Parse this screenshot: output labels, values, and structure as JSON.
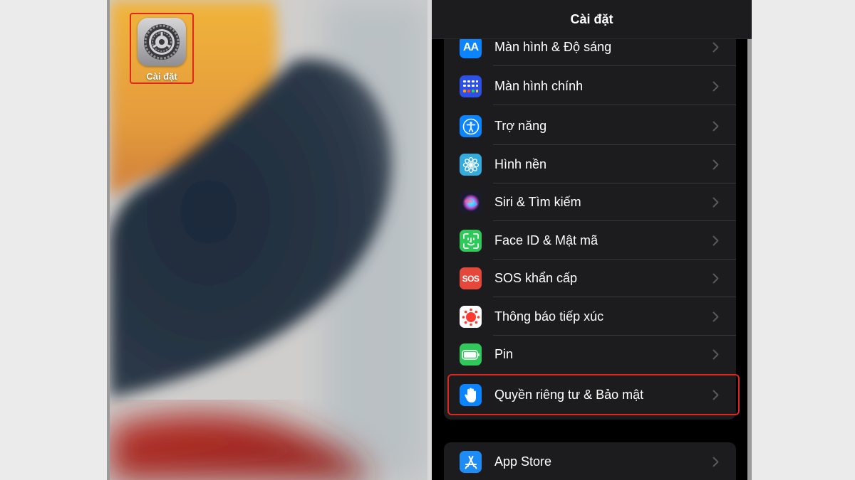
{
  "home_screen": {
    "app_label": "Cài đặt",
    "app_icon": "settings-gear-icon"
  },
  "settings": {
    "title": "Cài đặt",
    "rows": [
      {
        "label": "Màn hình & Độ sáng",
        "icon": "text-size-icon",
        "color": "#0a84ff"
      },
      {
        "label": "Màn hình chính",
        "icon": "home-screen-grid-icon",
        "color": "#2c50e8"
      },
      {
        "label": "Trợ năng",
        "icon": "accessibility-icon",
        "color": "#0a84ff"
      },
      {
        "label": "Hình nền",
        "icon": "wallpaper-flower-icon",
        "color": "#35aadc"
      },
      {
        "label": "Siri & Tìm kiếm",
        "icon": "siri-icon",
        "color": "#1b1b2e"
      },
      {
        "label": "Face ID & Mật mã",
        "icon": "face-id-icon",
        "color": "#30c85a"
      },
      {
        "label": "SOS khẩn cấp",
        "icon": "sos-icon",
        "color": "#e5483b"
      },
      {
        "label": "Thông báo tiếp xúc",
        "icon": "exposure-notification-icon",
        "color": "#ffffff"
      },
      {
        "label": "Pin",
        "icon": "battery-icon",
        "color": "#30c85a"
      },
      {
        "label": "Quyền riêng tư & Bảo mật",
        "icon": "privacy-hand-icon",
        "color": "#0a84ff"
      }
    ],
    "group2_rows": [
      {
        "label": "App Store",
        "icon": "app-store-icon",
        "color": "#1e8cf5"
      }
    ],
    "highlighted_row": "Quyền riêng tư & Bảo mật"
  },
  "colors": {
    "highlight": "#e0271c",
    "background": "#000000",
    "cell": "#1c1c1e"
  }
}
